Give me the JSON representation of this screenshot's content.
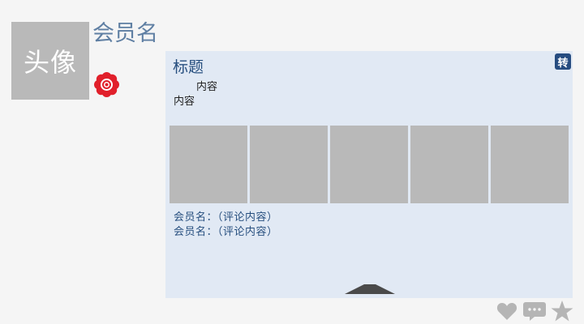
{
  "profile": {
    "avatar_label": "头像",
    "member_name": "会员名",
    "badge_icon": "flower-badge-icon"
  },
  "post": {
    "title": "标题",
    "repost_label": "转",
    "content_line1": "内容",
    "content_line2": "内容",
    "images": [
      {
        "icon": "image-placeholder"
      },
      {
        "icon": "image-placeholder"
      },
      {
        "icon": "image-placeholder"
      },
      {
        "icon": "image-placeholder"
      },
      {
        "icon": "image-placeholder"
      }
    ],
    "comments": [
      "会员名：（评论内容）",
      "会员名：（评论内容）"
    ],
    "collapse_icon": "collapse-up-icon"
  },
  "actions": {
    "like_icon": "heart-icon",
    "comment_icon": "comment-bubble-icon",
    "favorite_icon": "star-icon"
  },
  "colors": {
    "card_bg": "#e1e9f4",
    "title_color": "#274f7f",
    "name_color": "#5f7fa3",
    "placeholder": "#b9b9b9",
    "badge_red": "#e1202b",
    "action_gray": "#b5b5b5"
  }
}
